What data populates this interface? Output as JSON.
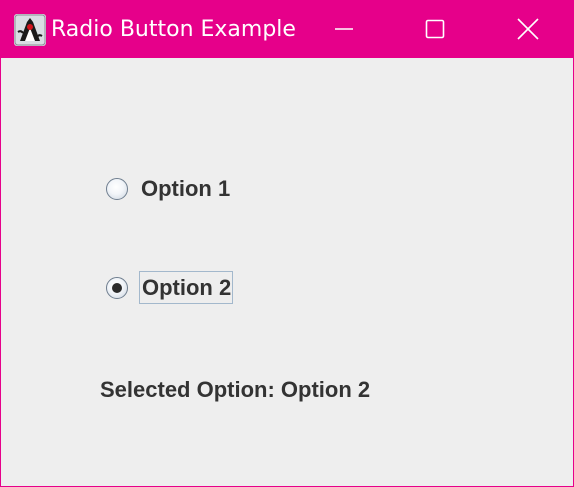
{
  "window": {
    "title": "Radio Button Example",
    "app_icon": "java-duke-icon",
    "controls": {
      "minimize_icon": "minimize-icon",
      "maximize_icon": "maximize-icon",
      "close_icon": "close-icon"
    },
    "titlebar_color": "#e6008a",
    "background_color": "#eeeeee"
  },
  "radio_group": {
    "options": [
      {
        "label": "Option 1",
        "selected": false
      },
      {
        "label": "Option 2",
        "selected": true,
        "focused": true
      }
    ]
  },
  "status": {
    "text": "Selected Option: Option 2"
  }
}
